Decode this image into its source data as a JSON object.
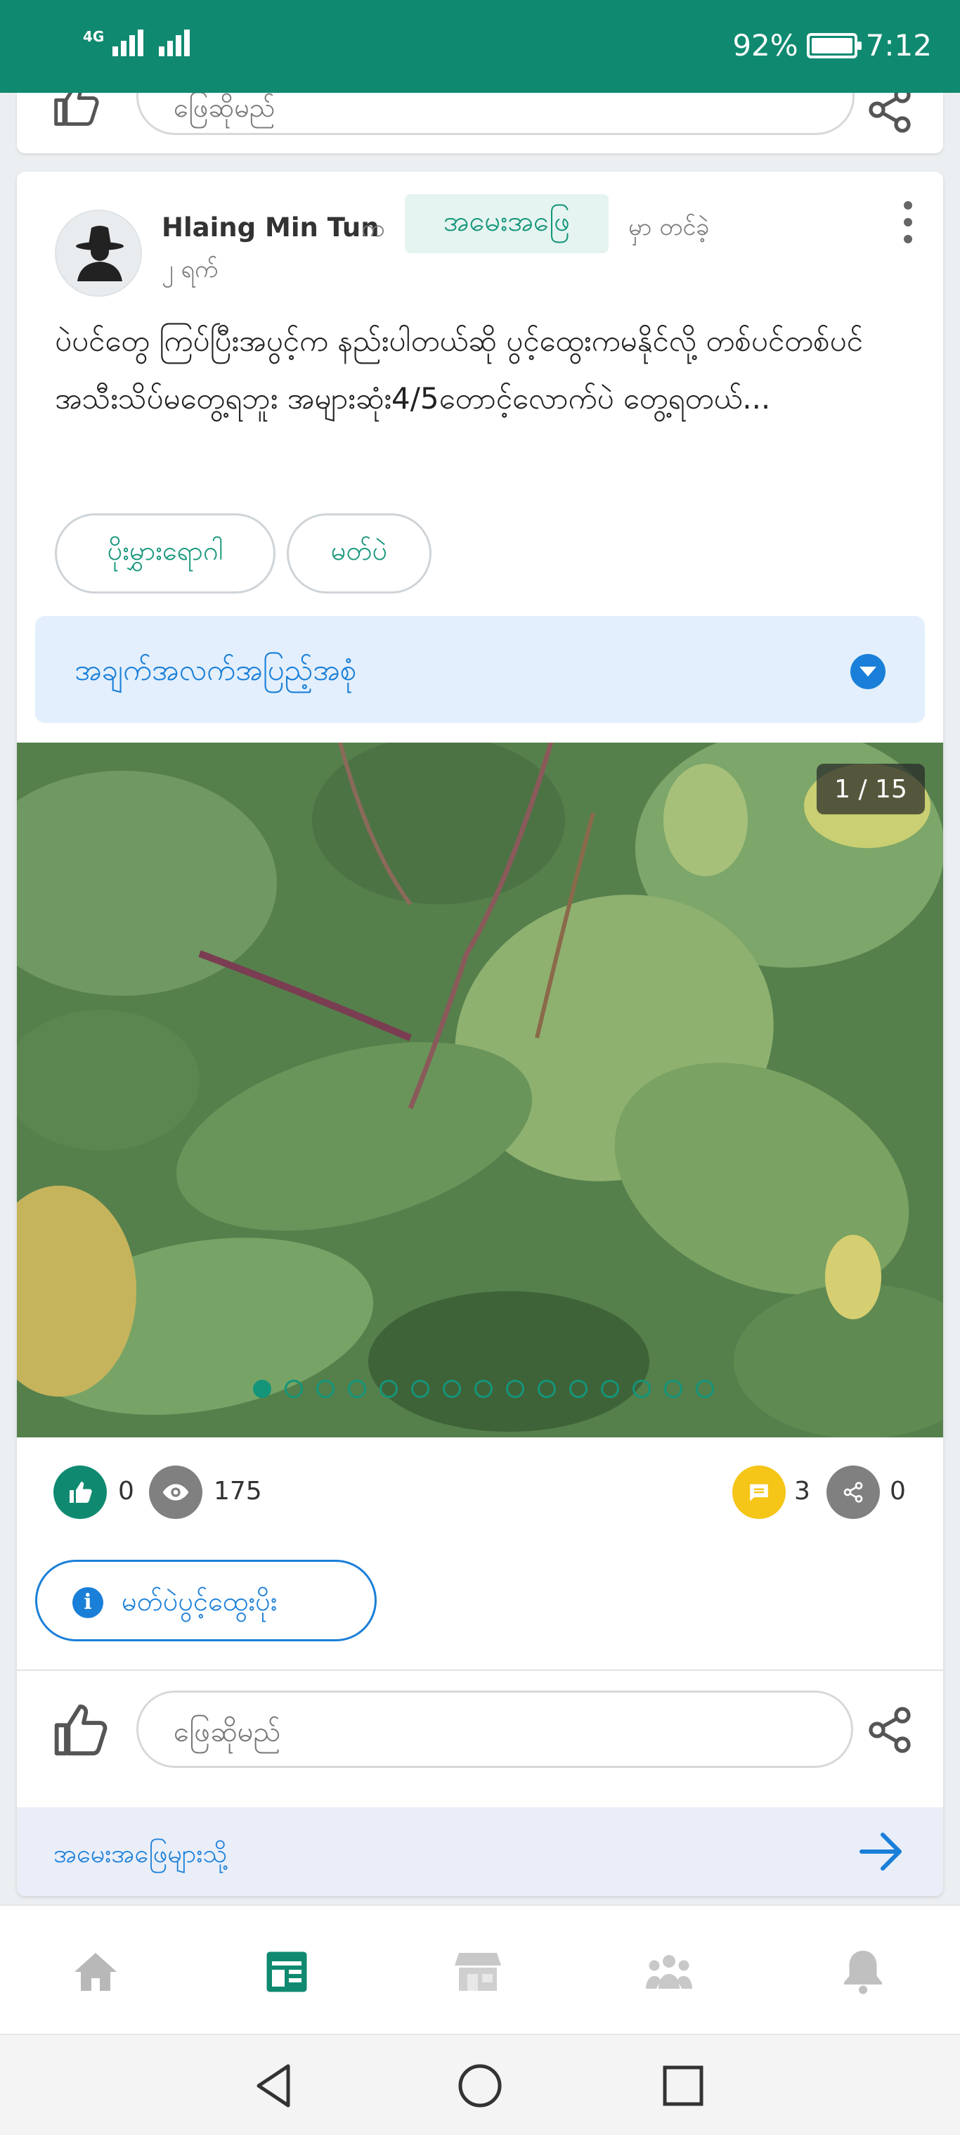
{
  "status_bar": {
    "network": "4G",
    "battery": "92%",
    "time": "7:12"
  },
  "previous_post": {
    "reply_placeholder": "ဖြေဆိုမည်"
  },
  "post": {
    "author": "Hlaing Min Tun",
    "particle_by": "က",
    "category": "အမေးအဖြေ",
    "posted_label": "မှာ တင်ခဲ့",
    "time_ago": "၂ ရက်",
    "body": "ပဲပင်တွေ ကြပ်ပြီးအပွင့်က နည်းပါတယ်ဆို ပွင့်ထွေးကမနိုင်လို့ တစ်ပင်တစ်ပင် အသီးသိပ်မတွေ့ရဘူး အများဆုံး4/5တောင့်လောက်ပဲ တွေ့ရတယ်...",
    "tags": [
      "ပိုးမွှားရောဂါ",
      "မတ်ပဲ"
    ],
    "details_label": "အချက်အလက်အပြည့်အစုံ",
    "image_counter": "1 / 15",
    "image_total": 15,
    "image_current": 1,
    "likes": "0",
    "views": "175",
    "comments": "3",
    "shares": "0",
    "note_button": "မတ်ပဲပွင့်ထွေးပိုး",
    "reply_placeholder": "ဖြေဆိုမည်",
    "to_answers_label": "အမေးအဖြေများသို့"
  },
  "colors": {
    "brand": "#0f8a70",
    "accent_blue": "#1a7fd8",
    "comment_badge": "#f5c518",
    "gray_badge": "#808080"
  },
  "tab_icons": [
    "home-icon",
    "feed-icon",
    "market-icon",
    "community-icon",
    "bell-icon"
  ],
  "active_tab": 1
}
